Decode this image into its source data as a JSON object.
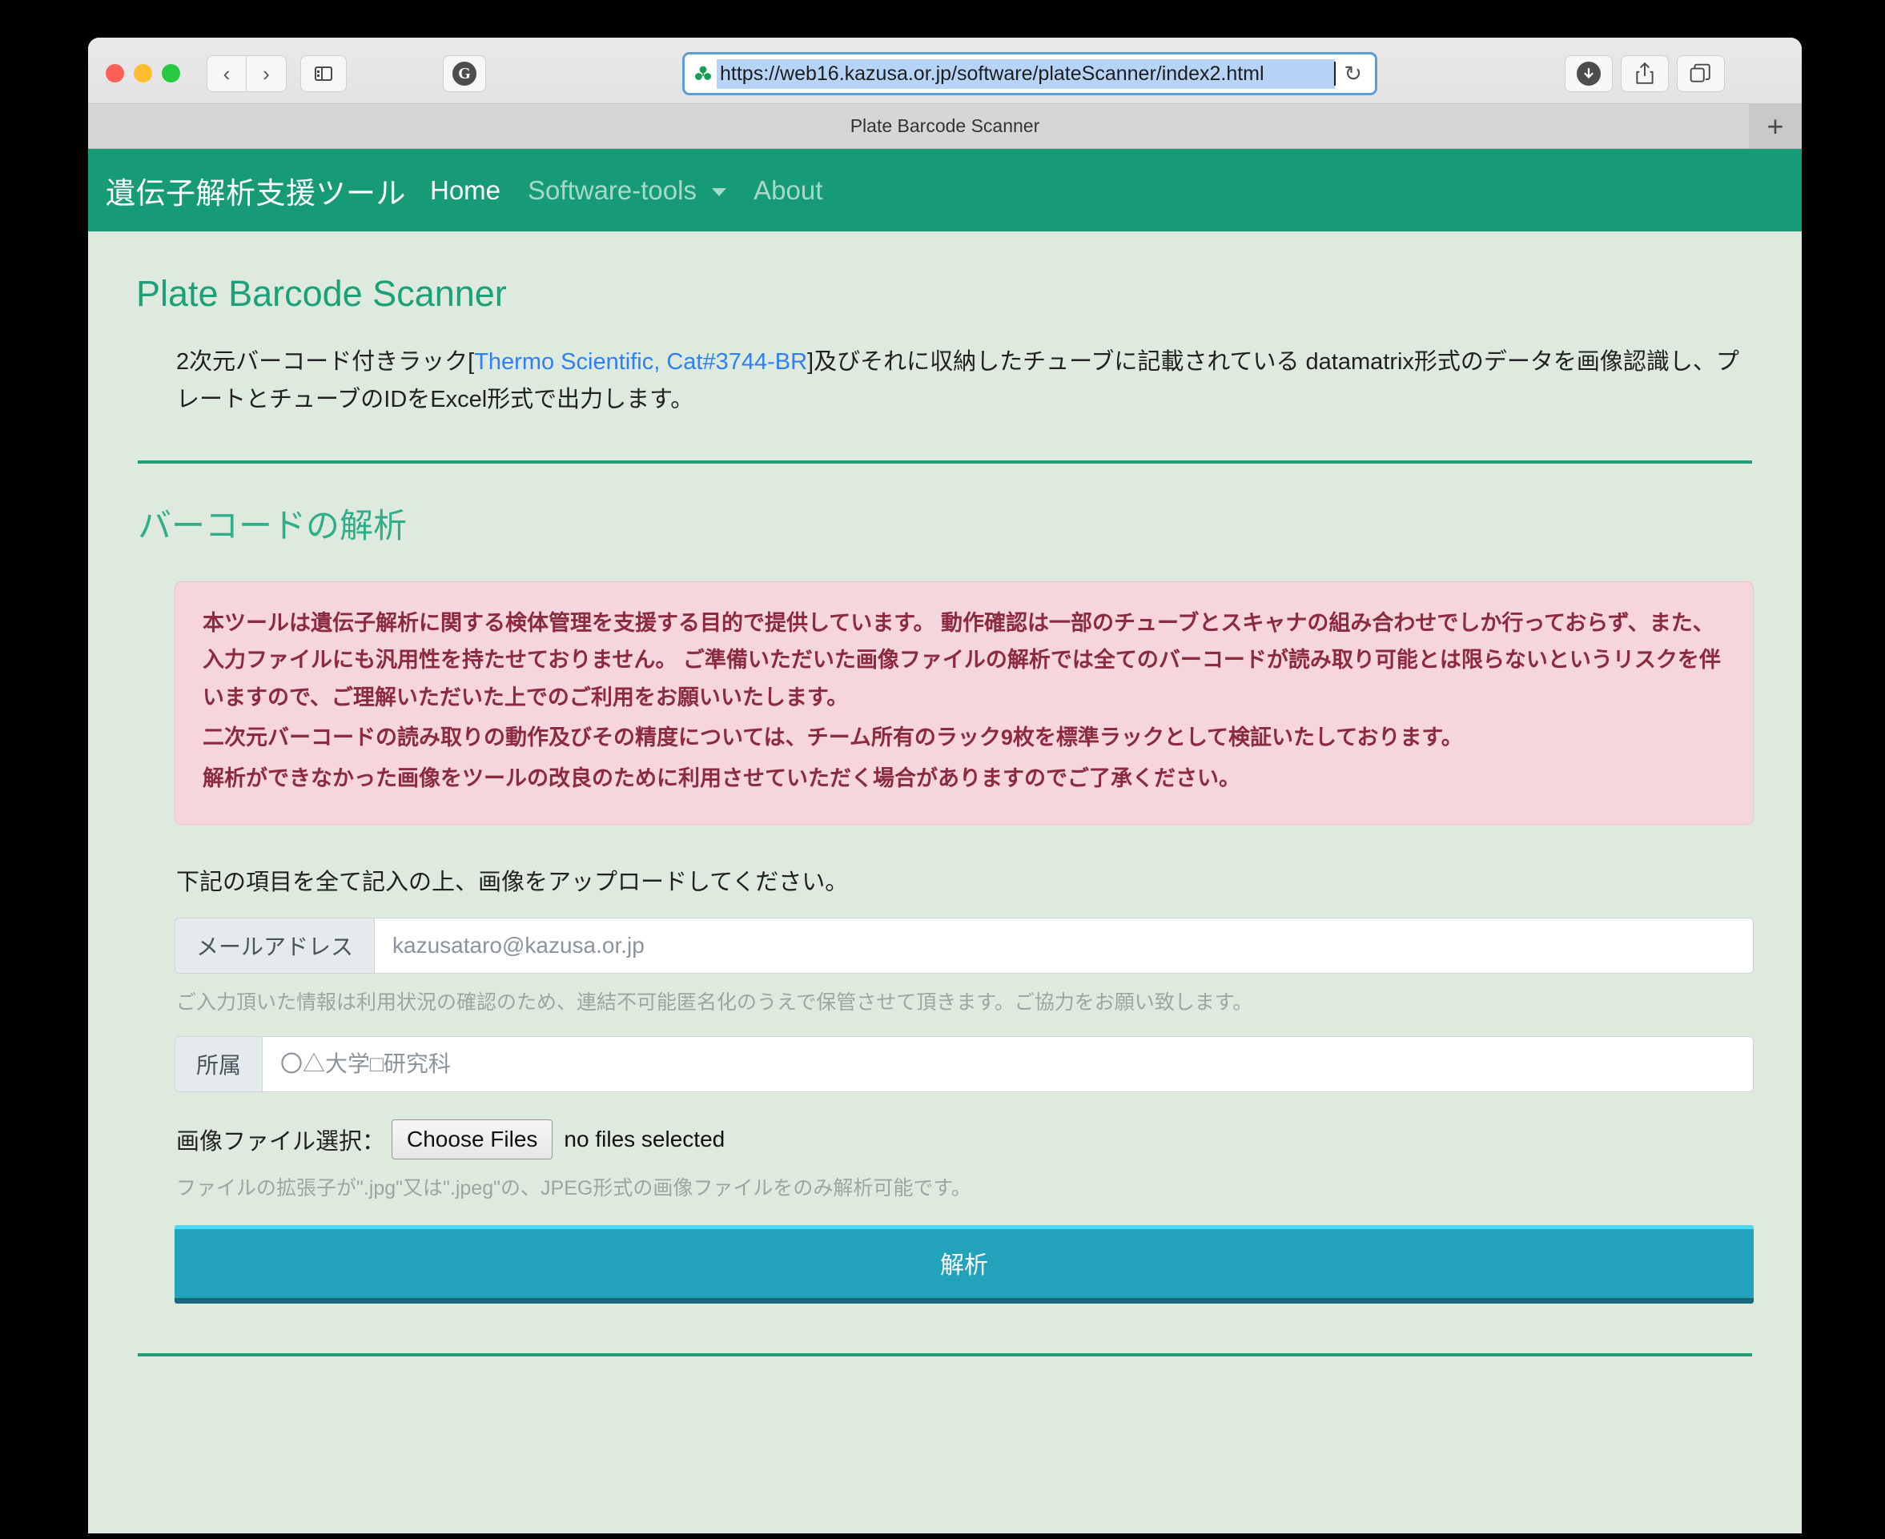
{
  "browser": {
    "url": "https://web16.kazusa.or.jp/software/plateScanner/index2.html",
    "tab_title": "Plate Barcode Scanner",
    "back_glyph": "‹",
    "forward_glyph": "›",
    "reload_glyph": "↻",
    "newtab_glyph": "+",
    "ghostery_glyph": "G",
    "icons": {
      "sidebar": "sidebar-icon",
      "ghostery": "ghostery-icon",
      "favicon": "clover-favicon",
      "download": "download-icon",
      "share": "share-icon",
      "tabs": "tab-overview-icon"
    }
  },
  "nav": {
    "brand": "遺伝子解析支援ツール",
    "links": [
      {
        "label": "Home",
        "active": true
      },
      {
        "label": "Software-tools",
        "active": false,
        "has_caret": true
      },
      {
        "label": "About",
        "active": false
      }
    ]
  },
  "main": {
    "page_title": "Plate Barcode Scanner",
    "intro": {
      "before_link": "2次元バーコード付きラック[",
      "link_text": "Thermo Scientific, Cat#3744-BR",
      "after_link": "]及びそれに収納したチューブに記載されている datamatrix形式のデータを画像認識し、プレートとチューブのIDをExcel形式で出力します。"
    },
    "section_title": "バーコードの解析",
    "alert_lines": [
      "本ツールは遺伝子解析に関する検体管理を支援する目的で提供しています。 動作確認は一部のチューブとスキャナの組み合わせでしか行っておらず、また、入力ファイルにも汎用性を持たせておりません。 ご準備いただいた画像ファイルの解析では全てのバーコードが読み取り可能とは限らないというリスクを伴いますので、ご理解いただいた上でのご利用をお願いいたします。",
      "二次元バーコードの読み取りの動作及びその精度については、チーム所有のラック9枚を標準ラックとして検証いたしております。",
      "解析ができなかった画像をツールの改良のために利用させていただく場合がありますのでご了承ください。"
    ],
    "upload_instruction": "下記の項目を全て記入の上、画像をアップロードしてください。",
    "email_field": {
      "label": "メールアドレス",
      "value": "",
      "placeholder": "kazusataro@kazusa.or.jp"
    },
    "email_helper": "ご入力頂いた情報は利用状況の確認のため、連結不可能匿名化のうえで保管させて頂きます。ご協力をお願い致します。",
    "affiliation_field": {
      "label": "所属",
      "value": "",
      "placeholder": "〇△大学□研究科"
    },
    "file_picker": {
      "label": "画像ファイル選択：",
      "button_label": "Choose Files",
      "status": "no files selected"
    },
    "file_helper": "ファイルの拡張子が\".jpg\"又は\".jpeg\"の、JPEG形式の画像ファイルをのみ解析可能です。",
    "submit_label": "解析"
  },
  "colors": {
    "nav_green": "#169b76",
    "page_bg": "#deeade",
    "heading_green": "#1aa179",
    "alert_bg": "#f6d5dc",
    "alert_text": "#8c2b3f",
    "link_blue": "#2d7ff9",
    "submit_teal": "#23a2bb"
  }
}
